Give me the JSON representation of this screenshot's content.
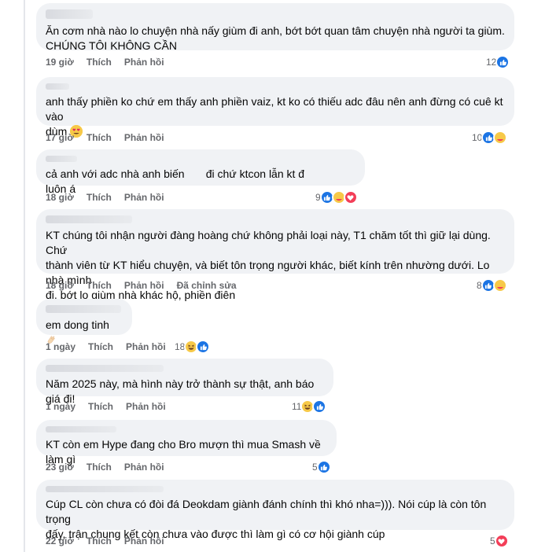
{
  "actions": {
    "like_label": "Thích",
    "reply_label": "Phản hồi",
    "edited_label": "Đã chỉnh sửa"
  },
  "comments": [
    {
      "text": "Ăn cơm nhà nào lo chuyện nhà nấy giùm đi anh, bớt bớt quan tâm chuyện nhà người ta giùm.\nCHÚNG TÔI KHÔNG CẦN",
      "time": "19 giờ",
      "count": "12",
      "reactions": [
        "like-icon"
      ]
    },
    {
      "text": "anh thấy phiền ko chứ em thấy anh phiền vaiz, kt ko có thiếu adc đâu nên anh đừng có cuê kt vào\ndùm",
      "emoji": "heart-eyes-emoji",
      "time": "17 giờ",
      "count": "10",
      "reactions": [
        "like-icon",
        "care-icon"
      ]
    },
    {
      "text": "cả anh với adc nhà anh biến       đi chứ ktcon lẫn kt đ             luôn á",
      "time": "18 giờ",
      "count": "9",
      "reactions": [
        "like-icon",
        "care-icon",
        "love-icon"
      ]
    },
    {
      "text": "KT chúng tôi nhận người đàng hoàng chứ không phải loại này, T1 chăm tốt thì giữ lại dùng. Chứ\nthành viên từ KT hiểu chuyện, và biết tôn trọng người khác, biết kính trên nhường dưới. Lo nhà mình\nđi, bớt lo giùm nhà khác hộ, phiền điên",
      "time": "18 giờ",
      "count": "8",
      "edited": true,
      "reactions": [
        "like-icon",
        "care-icon"
      ]
    },
    {
      "text": "em dong tinh",
      "emoji": "clap-emoji",
      "time": "1 ngày",
      "count": "18",
      "reactions": [
        "haha-icon",
        "like-icon"
      ]
    },
    {
      "text": "Năm 2025 này, mà hình này trở thành sự thật, anh báo giá đi!",
      "time": "1 ngày",
      "count": "11",
      "reactions": [
        "haha-icon",
        "like-icon"
      ]
    },
    {
      "text": "KT còn em Hype đang cho Bro mượn thì mua Smash về làm gì",
      "time": "23 giờ",
      "count": "5",
      "reactions": [
        "like-icon"
      ]
    },
    {
      "text": "Cúp CL còn chưa có đòi đá Deokdam giành đánh chính thì khó nha=))). Nói cúp là còn tôn trọng\nđấy, trận chung kết còn chưa vào được thì làm gì có cơ hội giành cúp",
      "time": "22 giờ",
      "count": "5",
      "reactions": [
        "love-icon"
      ]
    }
  ],
  "colors": {
    "like": "#1b74e4",
    "love": "#f33e58",
    "haha": "#f7c948",
    "bubble": "#f0f2f5",
    "meta": "#65676b"
  }
}
